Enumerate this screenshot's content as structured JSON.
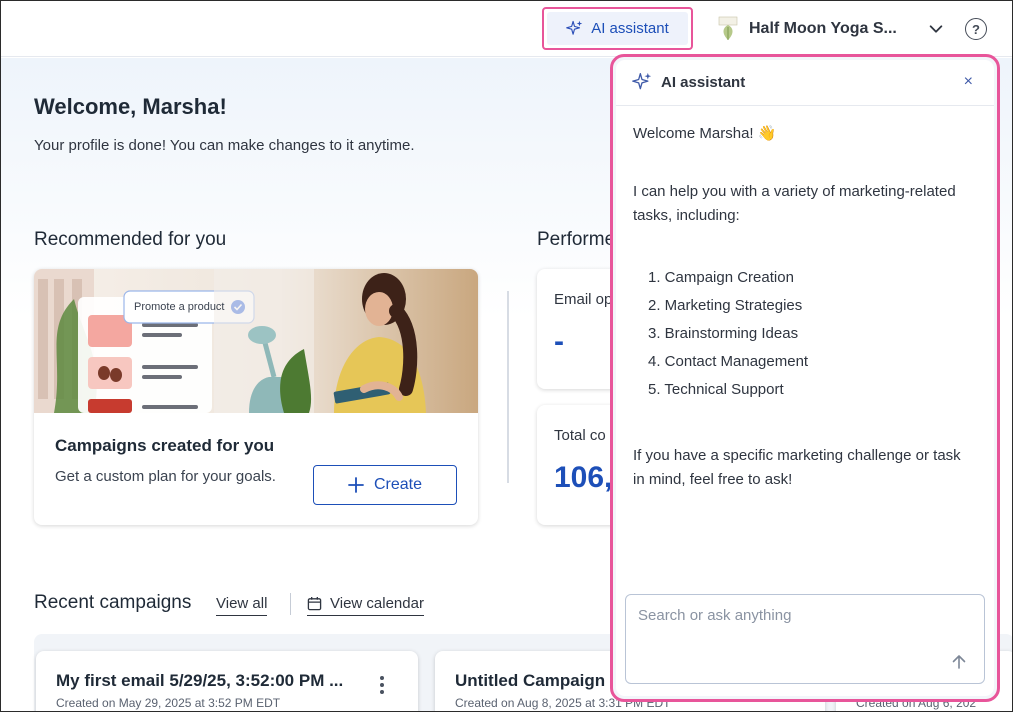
{
  "topbar": {
    "ai_button_label": "AI assistant",
    "account_name": "Half Moon Yoga S...",
    "help_label": "?",
    "account_logo_icon": "leaf-logo-icon"
  },
  "main": {
    "welcome_title": "Welcome, Marsha!",
    "welcome_subtitle": "Your profile is done! You can make changes to it anytime.",
    "recommended_title": "Recommended for you",
    "performance_title": "Performe",
    "recommend_card": {
      "badge": "Promote a product",
      "title": "Campaigns created for you",
      "subtitle": "Get a custom plan for your goals.",
      "create_label": "Create"
    },
    "perf_cards": [
      {
        "label": "Email op",
        "value": "-"
      },
      {
        "label": "Total co",
        "value": "106,"
      }
    ],
    "recent_title": "Recent campaigns",
    "view_all": "View all",
    "view_calendar": "View calendar",
    "recent_cards": [
      {
        "title": "My first email 5/29/25, 3:52:00 PM ...",
        "meta": "Created on May 29, 2025 at 3:52 PM EDT"
      },
      {
        "title": "Untitled Campaign",
        "meta": "Created on Aug 8, 2025 at 3:31 PM EDT"
      },
      {
        "title": "",
        "meta": "Created on Aug 6, 202"
      }
    ]
  },
  "assistant": {
    "title": "AI assistant",
    "close": "×",
    "greeting": "Welcome Marsha! 👋",
    "intro": "I can help you with a variety of marketing-related tasks, including:",
    "tasks": [
      "1. Campaign Creation",
      "2. Marketing Strategies",
      "3. Brainstorming Ideas",
      "4. Contact Management",
      "5. Technical Support"
    ],
    "outro": "If you have a specific marketing challenge or task in mind, feel free to ask!",
    "input_placeholder": "Search or ask anything"
  },
  "colors": {
    "accent": "#1d4fb8",
    "highlight": "#e8559a"
  }
}
